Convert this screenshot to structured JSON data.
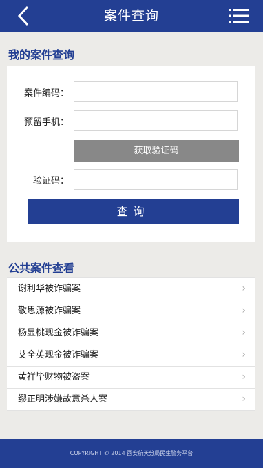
{
  "header": {
    "title": "案件查询",
    "back_icon": "chevron-left-icon",
    "menu_icon": "list-menu-icon"
  },
  "my_query": {
    "section_title": "我的案件查询",
    "case_number_label": "案件编码：",
    "case_number_value": "",
    "phone_label": "预留手机：",
    "phone_value": "",
    "get_code_button": "获取验证码",
    "verify_code_label": "验证码：",
    "verify_code_value": "",
    "query_button": "查询"
  },
  "public_cases": {
    "section_title": "公共案件查看",
    "items": [
      {
        "label": "谢利华被诈骗案"
      },
      {
        "label": "敬思源被诈骗案"
      },
      {
        "label": "杨显桃现金被诈骗案"
      },
      {
        "label": "艾全英现金被诈骗案"
      },
      {
        "label": "黄祥毕财物被盗案"
      },
      {
        "label": "缪正明涉嫌故意杀人案"
      }
    ]
  },
  "footer": {
    "text": "COPYRIGHT © 2014 西安航天分局民生警务平台"
  },
  "colors": {
    "brand": "#233f93",
    "background": "#ecebe8",
    "code_button": "#888888"
  }
}
